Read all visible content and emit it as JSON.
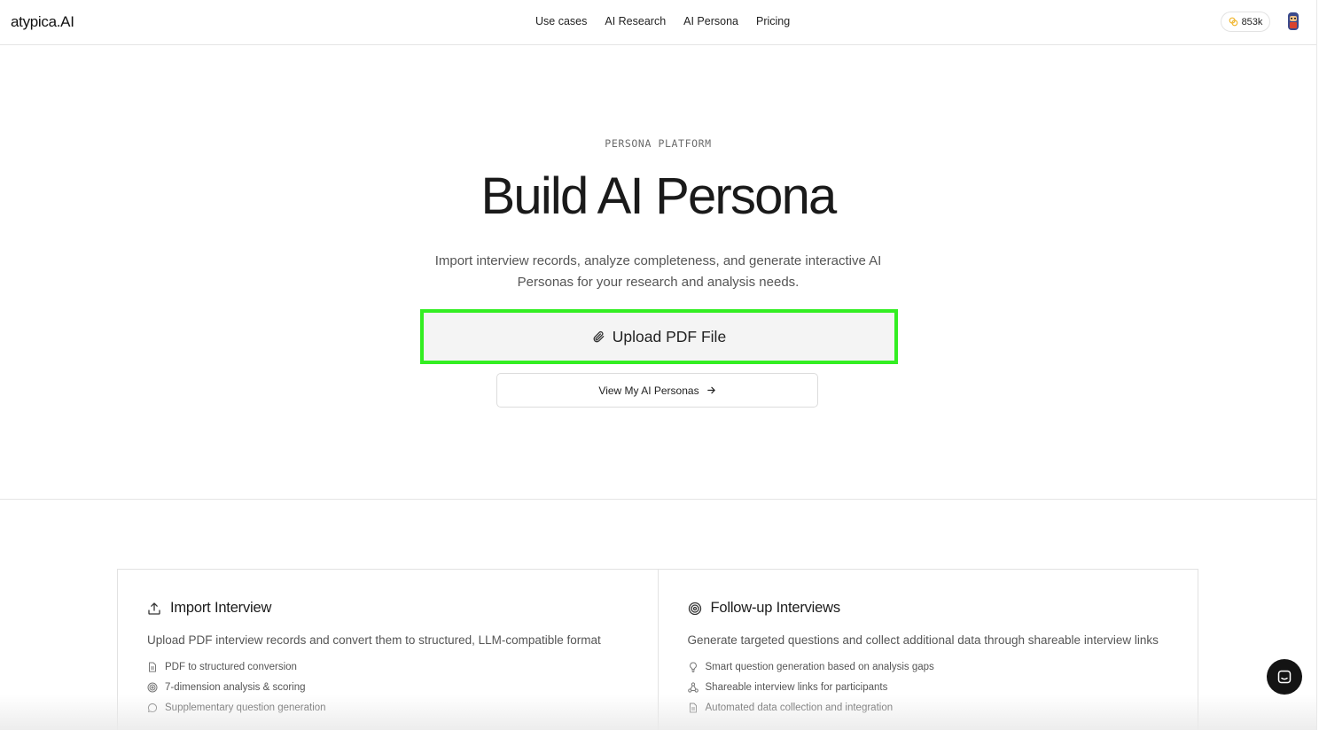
{
  "header": {
    "logo": "atypica.AI",
    "nav": [
      "Use cases",
      "AI Research",
      "AI Persona",
      "Pricing"
    ],
    "credits": "853k"
  },
  "hero": {
    "eyebrow": "PERSONA PLATFORM",
    "title": "Build AI Persona",
    "subtitle": "Import interview records, analyze completeness, and generate interactive AI Personas for your research and analysis needs.",
    "upload_label": "Upload PDF File",
    "view_label": "View My AI Personas"
  },
  "features": [
    {
      "title": "Import Interview",
      "icon": "upload-icon",
      "description": "Upload PDF interview records and convert them to structured, LLM-compatible format",
      "items": [
        {
          "icon": "document-icon",
          "text": "PDF to structured conversion"
        },
        {
          "icon": "target-icon",
          "text": "7-dimension analysis & scoring"
        },
        {
          "icon": "chat-bubble-icon",
          "text": "Supplementary question generation"
        }
      ]
    },
    {
      "title": "Follow-up Interviews",
      "icon": "target-icon",
      "description": "Generate targeted questions and collect additional data through shareable interview links",
      "items": [
        {
          "icon": "lightbulb-icon",
          "text": "Smart question generation based on analysis gaps"
        },
        {
          "icon": "share-network-icon",
          "text": "Shareable interview links for participants"
        },
        {
          "icon": "document-icon",
          "text": "Automated data collection and integration"
        }
      ]
    }
  ],
  "colors": {
    "upload_highlight": "#33ee22",
    "chat_button": "#141414",
    "coin": "#f0b429"
  }
}
